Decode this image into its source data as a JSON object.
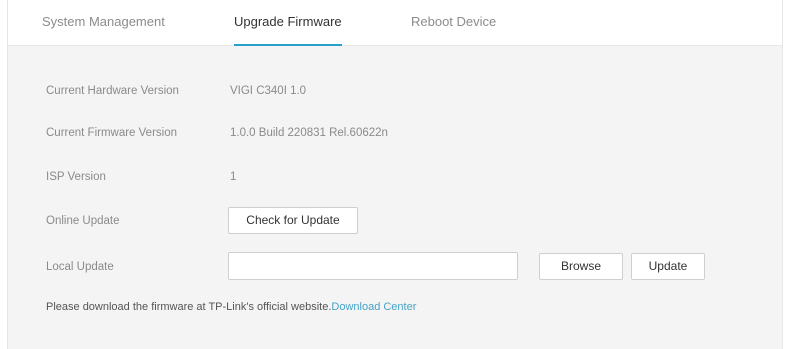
{
  "tabs": {
    "system_management": "System Management",
    "upgrade_firmware": "Upgrade Firmware",
    "reboot_device": "Reboot Device",
    "active": "upgrade_firmware"
  },
  "info": {
    "hardware_label": "Current Hardware Version",
    "hardware_value": "VIGI C340I 1.0",
    "firmware_label": "Current Firmware Version",
    "firmware_value": "1.0.0 Build 220831 Rel.60622n",
    "isp_label": "ISP Version",
    "isp_value": "1"
  },
  "online_update": {
    "label": "Online Update",
    "button": "Check for Update"
  },
  "local_update": {
    "label": "Local Update",
    "file_value": "",
    "browse_button": "Browse",
    "update_button": "Update"
  },
  "note": {
    "text": "Please download the firmware at TP-Link's official website.",
    "link": "Download Center"
  },
  "colors": {
    "accent": "#2aa0c8",
    "link": "#46a3c9"
  }
}
